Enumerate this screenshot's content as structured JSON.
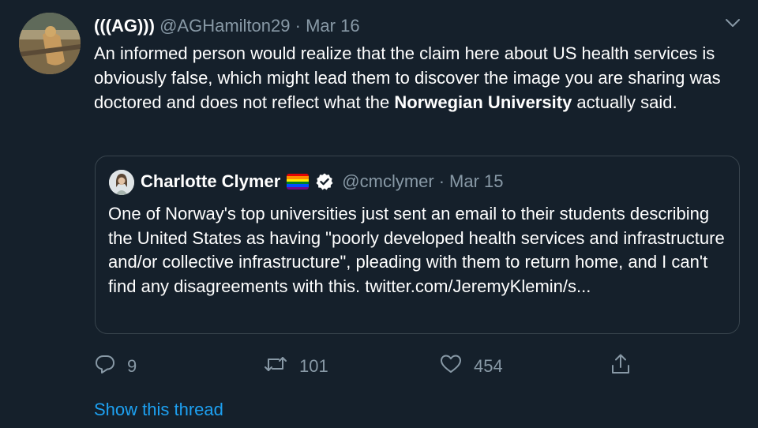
{
  "tweet": {
    "author_name": "(((AG)))",
    "author_handle": "@AGHamilton29",
    "separator": "·",
    "date": "Mar 16",
    "text_part1": "An informed person would realize that the claim here about US health services is obviously false, which might lead them to discover the image you are sharing was doctored and does not reflect what the ",
    "text_bold": "Norwegian University",
    "text_part2": " actually said."
  },
  "quoted_tweet": {
    "author_name": "Charlotte Clymer",
    "author_handle": "@cmclymer",
    "separator": "·",
    "date": "Mar 15",
    "text": "One of Norway's top universities just sent an email to their students describing the United States as having \"poorly developed health services and infrastructure and/or collective infrastructure\", pleading with them to return home, and I can't find any disagreements with this. twitter.com/JeremyKlemin/s..."
  },
  "actions": {
    "reply_count": "9",
    "retweet_count": "101",
    "like_count": "454"
  },
  "show_thread_label": "Show this thread",
  "icons": {
    "menu": "chevron-down-icon",
    "reply": "reply-icon",
    "retweet": "retweet-icon",
    "like": "heart-icon",
    "share": "share-icon",
    "verified": "verified-badge-icon",
    "flag": "rainbow-flag-icon"
  },
  "colors": {
    "background": "#15202b",
    "text": "#ffffff",
    "secondary_text": "#8899a6",
    "link": "#1da1f2",
    "border": "#38444d"
  }
}
